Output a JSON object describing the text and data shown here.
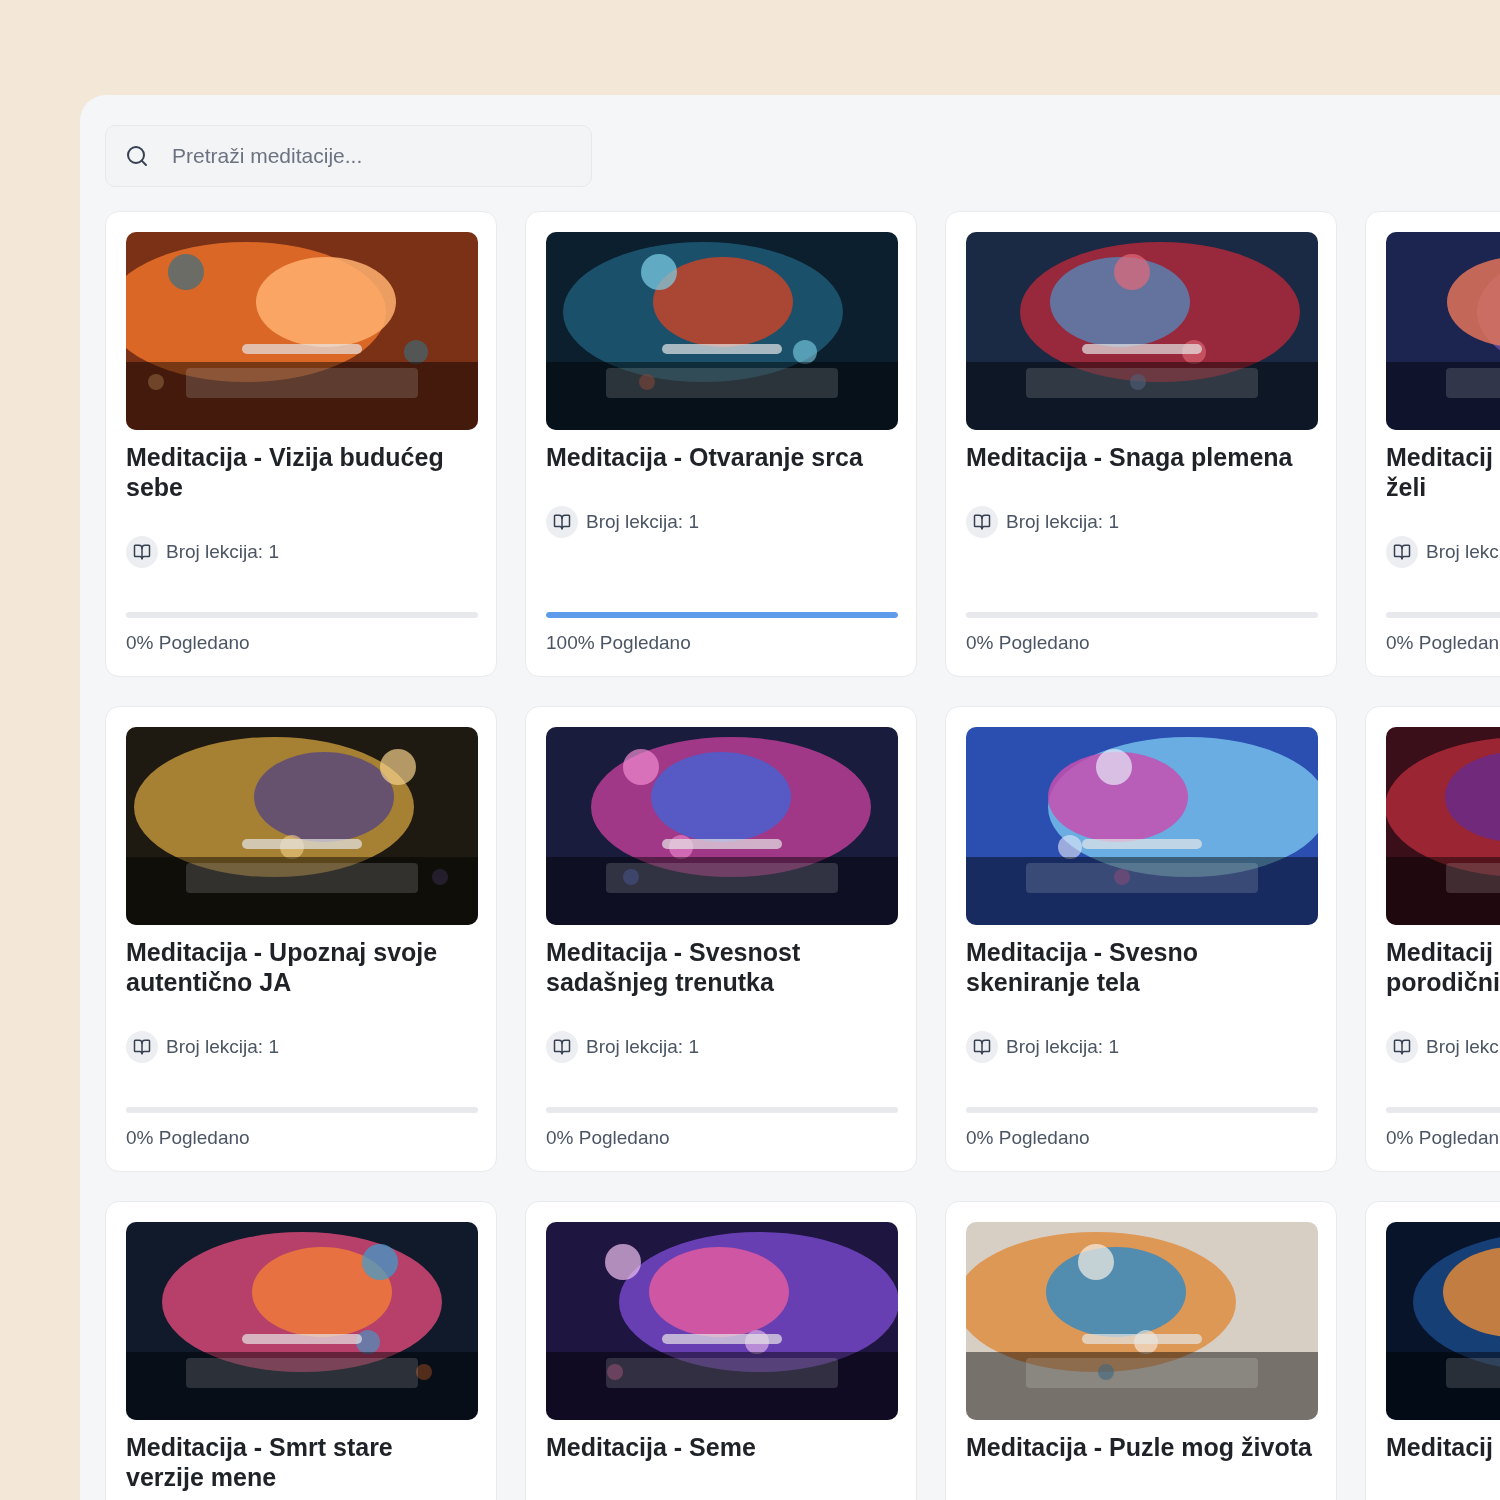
{
  "search": {
    "placeholder": "Pretraži meditacije..."
  },
  "rows": [
    {
      "cards": [
        {
          "title": "Meditacija - Vizija budućeg sebe",
          "lessons": "Broj lekcija: 1",
          "level": 0,
          "progress": "0% Pogledano"
        },
        {
          "title": "Meditacija - Otvaranje srca",
          "lessons": "Broj lekcija: 1",
          "level": 1,
          "progress": "100% Pogledano"
        },
        {
          "title": "Meditacija - Snaga plemena",
          "lessons": "Broj lekcija: 1",
          "level": 0,
          "progress": "0% Pogledano"
        },
        {
          "title": "Meditacij\nželi",
          "lessons": "Broj lekc",
          "level": 0,
          "progress": "0% Pogledan"
        }
      ]
    },
    {
      "cards": [
        {
          "title": "Meditacija - Upoznaj svoje autentično JA",
          "lessons": "Broj lekcija: 1",
          "level": 0,
          "progress": "0% Pogledano"
        },
        {
          "title": "Meditacija - Svesnost sadašnjeg trenutka",
          "lessons": "Broj lekcija: 1",
          "level": 0,
          "progress": "0% Pogledano"
        },
        {
          "title": "Meditacija - Svesno skeniranje tela",
          "lessons": "Broj lekcija: 1",
          "level": 0,
          "progress": "0% Pogledano"
        },
        {
          "title": "Meditacij\nporodični",
          "lessons": "Broj lekc",
          "level": 0,
          "progress": "0% Pogledan"
        }
      ]
    },
    {
      "cards": [
        {
          "title": "Meditacija - Smrt stare verzije mene"
        },
        {
          "title": "Meditacija - Seme"
        },
        {
          "title": "Meditacija - Puzle mog života"
        },
        {
          "title": "Meditacij"
        }
      ]
    }
  ]
}
